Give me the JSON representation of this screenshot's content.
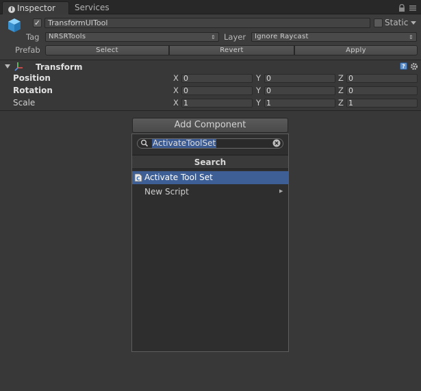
{
  "tabs": {
    "inspector": "Inspector",
    "services": "Services"
  },
  "object": {
    "active": "✓",
    "name": "TransformUITool",
    "static_label": "Static",
    "tag_label": "Tag",
    "tag_value": "NRSRTools",
    "layer_label": "Layer",
    "layer_value": "Ignore Raycast",
    "prefab_label": "Prefab",
    "prefab_select": "Select",
    "prefab_revert": "Revert",
    "prefab_apply": "Apply"
  },
  "transform": {
    "title": "Transform",
    "rows": [
      {
        "label": "Position",
        "x": "0",
        "y": "0",
        "z": "0"
      },
      {
        "label": "Rotation",
        "x": "0",
        "y": "0",
        "z": "0"
      },
      {
        "label": "Scale",
        "x": "1",
        "y": "1",
        "z": "1"
      }
    ],
    "axis_x": "X",
    "axis_y": "Y",
    "axis_z": "Z"
  },
  "add_component": {
    "button_label": "Add Component",
    "search_value": "ActivateToolSet",
    "section_title": "Search",
    "results": [
      {
        "label": "Activate Tool Set",
        "selected": true
      },
      {
        "label": "New Script",
        "submenu": true
      }
    ]
  },
  "colors": {
    "background": "#383838",
    "selection": "#3e5f96",
    "cube": "#4aa8e0"
  },
  "icons": {
    "info": "info-icon",
    "lock": "lock-icon",
    "menu": "menu-icon",
    "cube": "gameobject-cube-icon",
    "transform": "transform-axes-icon",
    "help": "help-icon",
    "gear": "gear-icon",
    "search": "search-icon",
    "clear": "clear-icon",
    "script": "script-icon"
  }
}
